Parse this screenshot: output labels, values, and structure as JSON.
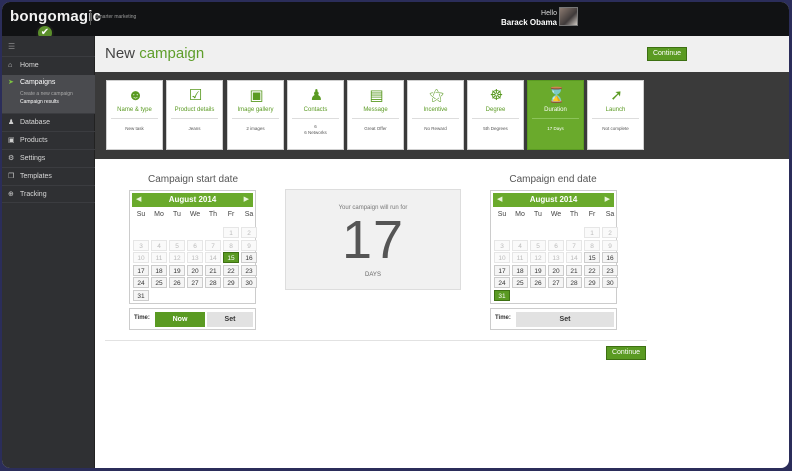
{
  "app": {
    "logo": "bongomagic",
    "tagline": "smarter marketing",
    "hello": "Hello",
    "user_name": "Barack Obama"
  },
  "sidebar": {
    "items": [
      {
        "label": "Home",
        "icon": "home-icon"
      },
      {
        "label": "Campaigns",
        "icon": "paper-plane-icon"
      },
      {
        "label": "Database",
        "icon": "users-icon"
      },
      {
        "label": "Products",
        "icon": "briefcase-icon"
      },
      {
        "label": "Settings",
        "icon": "gear-icon"
      },
      {
        "label": "Templates",
        "icon": "copy-icon"
      },
      {
        "label": "Tracking",
        "icon": "crosshair-icon"
      }
    ],
    "sub_items": [
      "Create a new campaign",
      "Campaign results"
    ]
  },
  "header": {
    "title_prefix": "New",
    "title_accent": "campaign",
    "continue_label": "Continue"
  },
  "steps": [
    {
      "title": "Name & type",
      "value": "New task",
      "icon": "person-icon"
    },
    {
      "title": "Product details",
      "value": "Jeans",
      "icon": "checklist-icon"
    },
    {
      "title": "Image gallery",
      "value": "2 images",
      "icon": "image-icon"
    },
    {
      "title": "Contacts",
      "value": "6",
      "value2": "6 Networks",
      "icon": "group-icon"
    },
    {
      "title": "Message",
      "value": "Great Offer",
      "icon": "document-icon"
    },
    {
      "title": "Incentive",
      "value": "No Reward",
      "icon": "ribbon-icon"
    },
    {
      "title": "Degree",
      "value": "5th Degrees",
      "icon": "network-icon"
    },
    {
      "title": "Duration",
      "value": "17 Days",
      "icon": "hourglass-icon"
    },
    {
      "title": "Launch",
      "value": "Not complete",
      "icon": "rocket-icon"
    }
  ],
  "start_calendar": {
    "label": "Campaign start date",
    "month": "August 2014",
    "dow": [
      "Su",
      "Mo",
      "Tu",
      "We",
      "Th",
      "Fr",
      "Sa"
    ],
    "selected_day": 15,
    "time_label": "Time:",
    "now_label": "Now",
    "set_label": "Set"
  },
  "end_calendar": {
    "label": "Campaign end date",
    "month": "August 2014",
    "dow": [
      "Su",
      "Mo",
      "Tu",
      "We",
      "Th",
      "Fr",
      "Sa"
    ],
    "selected_day": 31,
    "time_label": "Time:",
    "set_label": "Set"
  },
  "summary": {
    "line1": "Your campaign will run for",
    "days": "17",
    "unit": "DAYS"
  },
  "footer": {
    "continue_label": "Continue"
  },
  "colors": {
    "accent": "#5a9a22",
    "topbar": "#111214",
    "sidebar": "#2f3033"
  }
}
